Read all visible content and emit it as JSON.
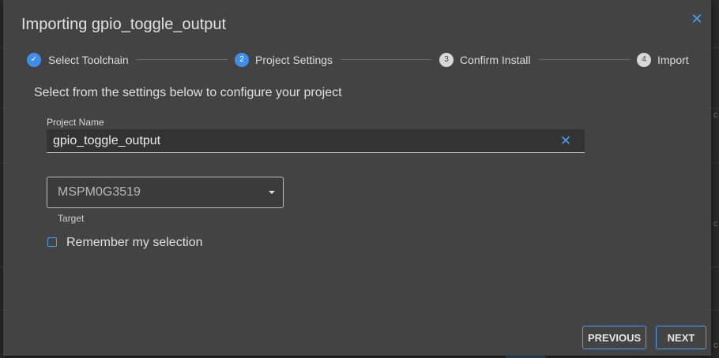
{
  "dialog": {
    "title": "Importing gpio_toggle_output",
    "close_icon": "close-icon",
    "subtitle": "Select from the settings below to configure your project"
  },
  "stepper": {
    "steps": [
      {
        "label": "Select Toolchain",
        "marker": "✓",
        "state": "done"
      },
      {
        "label": "Project Settings",
        "marker": "2",
        "state": "active"
      },
      {
        "label": "Confirm Install",
        "marker": "3",
        "state": "todo"
      },
      {
        "label": "Import",
        "marker": "4",
        "state": "todo"
      }
    ]
  },
  "form": {
    "project_name_label": "Project Name",
    "project_name_value": "gpio_toggle_output",
    "target_value": "MSPM0G3519",
    "target_label": "Target",
    "remember_label": "Remember my selection",
    "remember_checked": false
  },
  "footer": {
    "previous_label": "PREVIOUS",
    "next_label": "NEXT"
  },
  "colors": {
    "accent": "#3f8fe8",
    "dialog_bg": "#434343"
  }
}
